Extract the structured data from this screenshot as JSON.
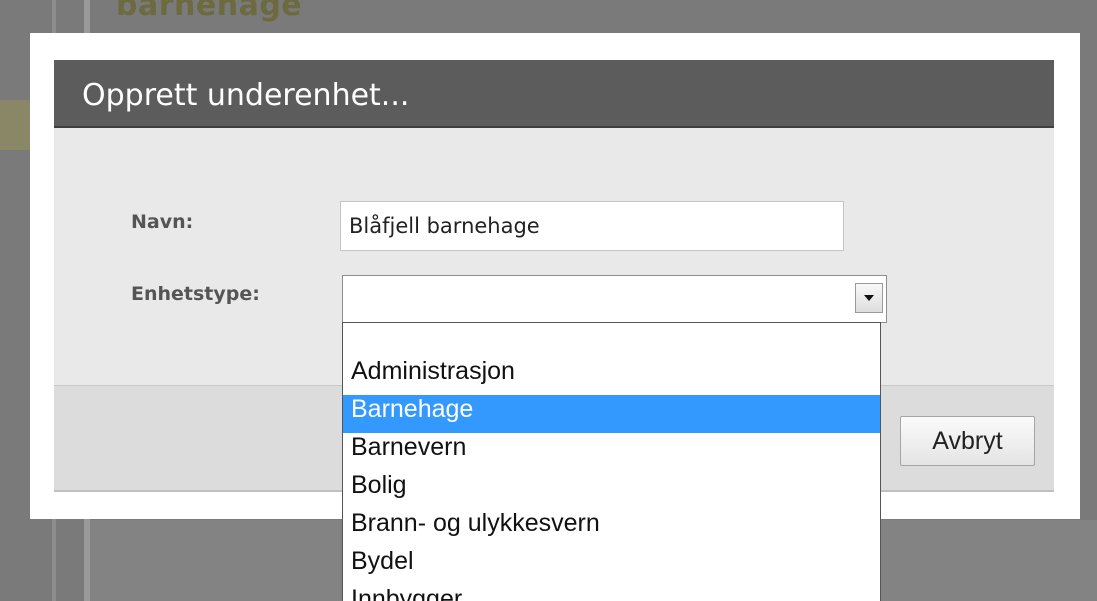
{
  "background": {
    "heading": "barnehage"
  },
  "modal": {
    "title": "Opprett underenhet...",
    "fields": {
      "name_label": "Navn:",
      "name_value": "Blåfjell barnehage",
      "type_label": "Enhetstype:",
      "type_value": ""
    },
    "dropdown": {
      "options": [
        "",
        "Administrasjon",
        "Barnehage",
        "Barnevern",
        "Bolig",
        "Brann- og ulykkesvern",
        "Bydel",
        "Innbygger"
      ],
      "highlighted": "Barnehage"
    },
    "buttons": {
      "cancel": "Avbryt"
    }
  },
  "colors": {
    "title_bar": "#5c5c5c",
    "highlight": "#3399ff",
    "overlay": "#7a7a7a"
  },
  "icons": {
    "select_arrow": "chevron-down-icon"
  }
}
